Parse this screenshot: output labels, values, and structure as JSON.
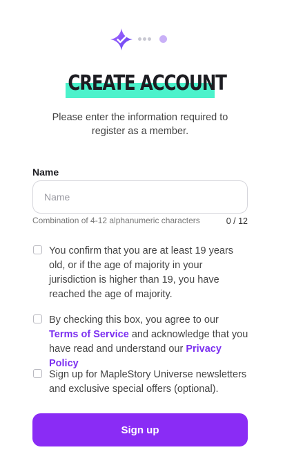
{
  "colors": {
    "accent": "#8a2cf5",
    "title_highlight": "#4cf2cb",
    "link": "#7b2ff0"
  },
  "progress": {
    "icon": "star-check-icon",
    "current_step": 1,
    "steps": 2
  },
  "header": {
    "title": "CREATE ACCOUNT",
    "subtitle": "Please enter the information required to register as a member."
  },
  "name_field": {
    "label": "Name",
    "placeholder": "Name",
    "value": "",
    "hint": "Combination of 4-12 alphanumeric characters",
    "counter": "0 / 12"
  },
  "consents": {
    "age": {
      "checked": false,
      "text": "You confirm that you are at least 19 years old, or if the age of majority in your jurisdiction is higher than 19, you have reached the age of majority."
    },
    "terms": {
      "checked": false,
      "pre": "By checking this box, you agree to our ",
      "terms_link": "Terms of Service",
      "mid": " and acknowledge that you have read and understand our ",
      "privacy_link": "Privacy Policy"
    },
    "newsletter": {
      "checked": false,
      "text": "Sign up for MapleStory Universe newsletters and exclusive special offers (optional)."
    }
  },
  "actions": {
    "signup_label": "Sign up"
  }
}
